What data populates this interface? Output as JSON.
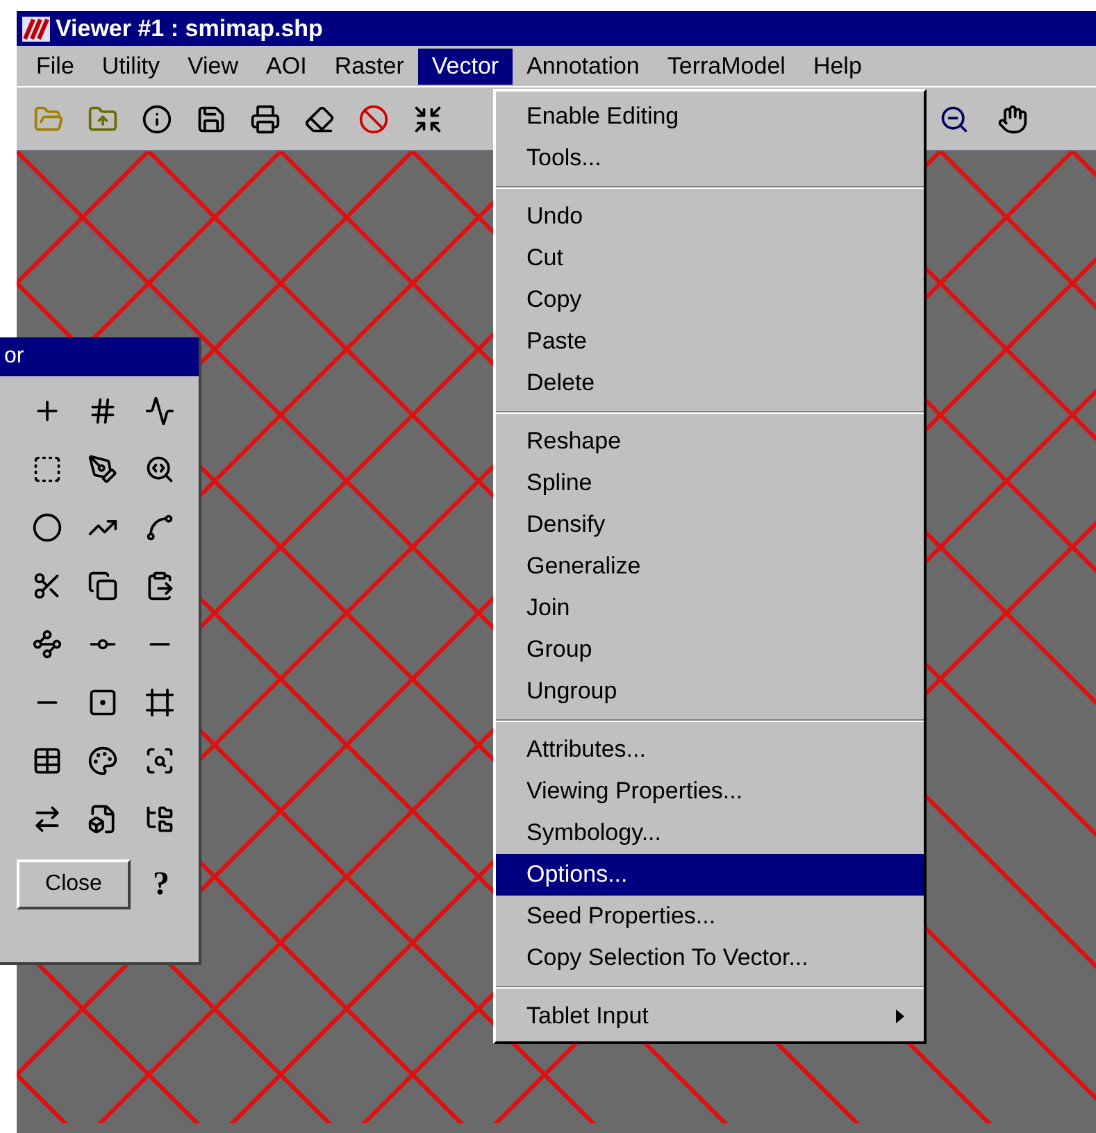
{
  "window": {
    "title": "Viewer #1 : smimap.shp"
  },
  "menu_bar": [
    {
      "label": "File",
      "selected": false
    },
    {
      "label": "Utility",
      "selected": false
    },
    {
      "label": "View",
      "selected": false
    },
    {
      "label": "AOI",
      "selected": false
    },
    {
      "label": "Raster",
      "selected": false
    },
    {
      "label": "Vector",
      "selected": true
    },
    {
      "label": "Annotation",
      "selected": false
    },
    {
      "label": "TerraModel",
      "selected": false
    },
    {
      "label": "Help",
      "selected": false
    }
  ],
  "vector_menu": [
    {
      "kind": "item",
      "label": "Enable Editing",
      "selected": false
    },
    {
      "kind": "item",
      "label": "Tools...",
      "selected": false
    },
    {
      "kind": "separator"
    },
    {
      "kind": "item",
      "label": "Undo",
      "selected": false
    },
    {
      "kind": "item",
      "label": "Cut",
      "selected": false
    },
    {
      "kind": "item",
      "label": "Copy",
      "selected": false
    },
    {
      "kind": "item",
      "label": "Paste",
      "selected": false
    },
    {
      "kind": "item",
      "label": "Delete",
      "selected": false
    },
    {
      "kind": "separator"
    },
    {
      "kind": "item",
      "label": "Reshape",
      "selected": false
    },
    {
      "kind": "item",
      "label": "Spline",
      "selected": false
    },
    {
      "kind": "item",
      "label": "Densify",
      "selected": false
    },
    {
      "kind": "item",
      "label": "Generalize",
      "selected": false
    },
    {
      "kind": "item",
      "label": "Join",
      "selected": false
    },
    {
      "kind": "item",
      "label": "Group",
      "selected": false
    },
    {
      "kind": "item",
      "label": "Ungroup",
      "selected": false
    },
    {
      "kind": "separator"
    },
    {
      "kind": "item",
      "label": "Attributes...",
      "selected": false
    },
    {
      "kind": "item",
      "label": "Viewing Properties...",
      "selected": false
    },
    {
      "kind": "item",
      "label": "Symbology...",
      "selected": false
    },
    {
      "kind": "item",
      "label": "Options...",
      "selected": true
    },
    {
      "kind": "item",
      "label": "Seed Properties...",
      "selected": false
    },
    {
      "kind": "item",
      "label": "Copy Selection To Vector...",
      "selected": false
    },
    {
      "kind": "separator"
    },
    {
      "kind": "submenu",
      "label": "Tablet Input",
      "selected": false
    }
  ],
  "tool_palette": {
    "title": "or",
    "close_button": "Close",
    "help_button": "?"
  }
}
